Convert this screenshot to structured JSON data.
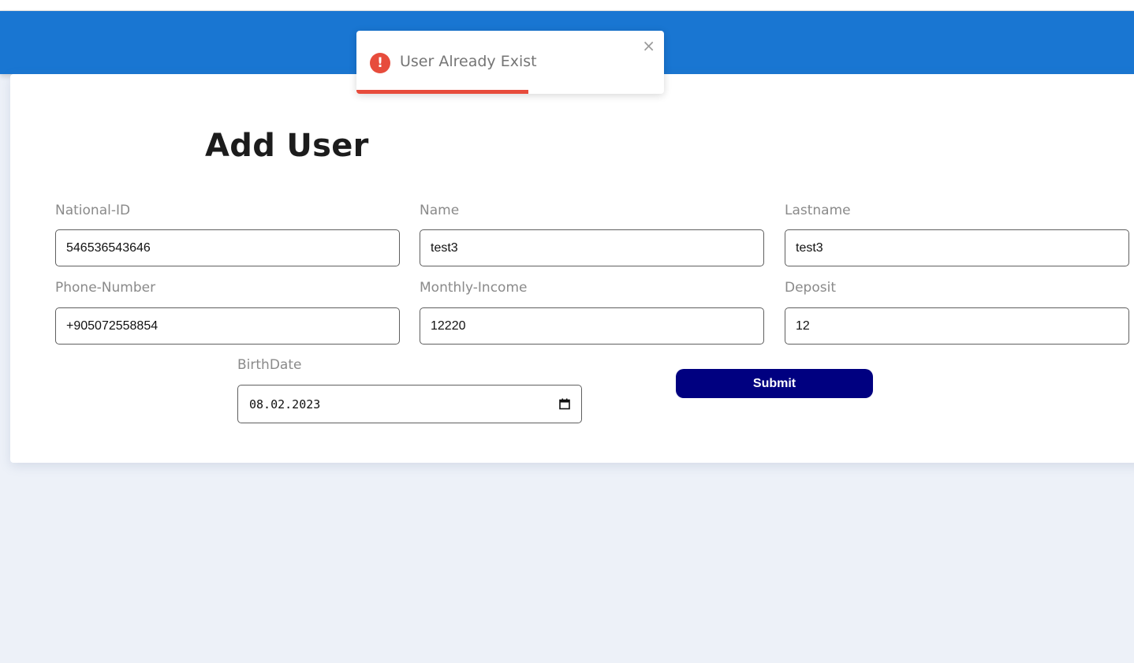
{
  "app": {
    "header_color": "#1976d2"
  },
  "toast": {
    "message": "User Already Exist",
    "close": "×",
    "icon": "!",
    "progress_remaining": 0.56,
    "color": "#e74c3c"
  },
  "form": {
    "title": "Add User",
    "fields": {
      "national_id": {
        "label": "National-ID",
        "value": "546536543646"
      },
      "name": {
        "label": "Name",
        "value": "test3"
      },
      "lastname": {
        "label": "Lastname",
        "value": "test3"
      },
      "phone": {
        "label": "Phone-Number",
        "value": "+905072558854"
      },
      "income": {
        "label": "Monthly-Income",
        "value": "12220"
      },
      "deposit": {
        "label": "Deposit",
        "value": "12"
      },
      "birthdate": {
        "label": "BirthDate",
        "value": "08.02.2023",
        "icon": "calendar-icon"
      }
    },
    "submit_label": "Submit",
    "submit_color": "#000080"
  }
}
